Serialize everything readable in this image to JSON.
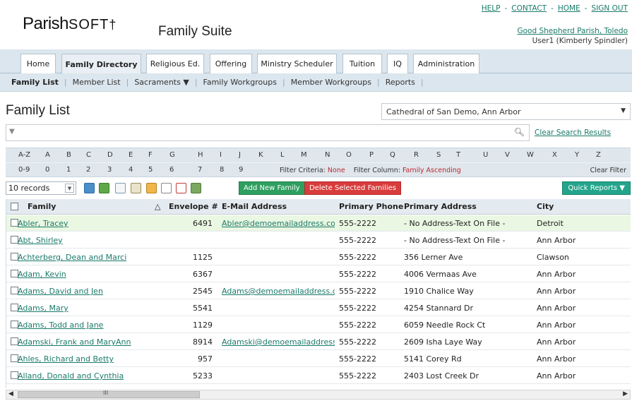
{
  "header": {
    "logo_main": "Parish",
    "logo_soft": "SOFT",
    "suite_title": "Family Suite",
    "links": [
      "HELP",
      "CONTACT",
      "HOME",
      "SIGN OUT"
    ],
    "parish_link": "Good Shepherd Parish, Toledo",
    "user_info": "User1 (Kimberly Spindler)"
  },
  "tabs": [
    {
      "label": "Home"
    },
    {
      "label": "Family Directory",
      "active": true
    },
    {
      "label": "Religious Ed."
    },
    {
      "label": "Offering"
    },
    {
      "label": "Ministry Scheduler"
    },
    {
      "label": "Tuition"
    },
    {
      "label": "IQ"
    },
    {
      "label": "Administration"
    }
  ],
  "subnav": {
    "family_list": "Family List",
    "member_list": "Member List",
    "sacraments": "Sacraments ▼",
    "family_workgroups": "Family Workgroups",
    "member_workgroups": "Member Workgroups",
    "reports": "Reports"
  },
  "page": {
    "title": "Family List",
    "parish_select": "Cathedral of San Demo, Ann Arbor",
    "clear_search": "Clear Search Results"
  },
  "alpha_row1": [
    "A-Z",
    "A",
    "B",
    "C",
    "D",
    "E",
    "F",
    "G",
    "H",
    "I",
    "J",
    "K",
    "L",
    "M",
    "N",
    "O",
    "P",
    "Q",
    "R",
    "S",
    "T",
    "U",
    "V",
    "W",
    "X",
    "Y",
    "Z"
  ],
  "alpha_row2": [
    "0-9",
    "0",
    "1",
    "2",
    "3",
    "4",
    "5",
    "6",
    "7",
    "8",
    "9"
  ],
  "filter": {
    "criteria_label": "Filter Criteria:",
    "criteria_value": "None",
    "column_label": "Filter Column:",
    "column_value": "Family Ascending",
    "clear_label": "Clear Filter"
  },
  "toolbar": {
    "records": "10 records",
    "add_button": "Add New Family",
    "delete_button": "Delete Selected Families",
    "quick_reports": "Quick Reports ▼"
  },
  "columns": {
    "family": "Family",
    "sort_indicator": "△",
    "envelope": "Envelope #",
    "email": "E-Mail Address",
    "phone": "Primary Phone",
    "address": "Primary Address",
    "city": "City"
  },
  "rows": [
    {
      "family": "Abler, Tracey",
      "envelope": "6491",
      "email": "Abler@demoemailaddress.com",
      "phone": "555-2222",
      "address": "- No Address-Text On File -",
      "city": "Detroit",
      "highlight": true
    },
    {
      "family": "Abt, Shirley",
      "envelope": "",
      "email": "",
      "phone": "555-2222",
      "address": "- No Address-Text On File -",
      "city": "Ann Arbor"
    },
    {
      "family": "Achterberg, Dean and Marci",
      "envelope": "1125",
      "email": "",
      "phone": "555-2222",
      "address": "356 Lerner Ave",
      "city": "Clawson"
    },
    {
      "family": "Adam, Kevin",
      "envelope": "6367",
      "email": "",
      "phone": "555-2222",
      "address": "4006 Vermaas Ave",
      "city": "Ann Arbor"
    },
    {
      "family": "Adams, David and Jen",
      "envelope": "2545",
      "email": "Adams@demoemailaddress.con",
      "phone": "555-2222",
      "address": "1910 Chalice Way",
      "city": "Ann Arbor"
    },
    {
      "family": "Adams, Mary",
      "envelope": "5541",
      "email": "",
      "phone": "555-2222",
      "address": "4254 Stannard Dr",
      "city": "Ann Arbor"
    },
    {
      "family": "Adams, Todd and Jane",
      "envelope": "1129",
      "email": "",
      "phone": "555-2222",
      "address": "6059 Needle Rock Ct",
      "city": "Ann Arbor"
    },
    {
      "family": "Adamski, Frank and MaryAnn",
      "envelope": "8914",
      "email": "Adamski@demoemailaddress.cc",
      "phone": "555-2222",
      "address": "2609 Isha Laye Way",
      "city": "Ann Arbor"
    },
    {
      "family": "Ahles, Richard and Betty",
      "envelope": "957",
      "email": "",
      "phone": "555-2222",
      "address": "5141 Corey Rd",
      "city": "Ann Arbor"
    },
    {
      "family": "Alland, Donald and Cynthia",
      "envelope": "5233",
      "email": "",
      "phone": "555-2222",
      "address": "2403 Lost Creek Dr",
      "city": "Ann Arbor"
    }
  ],
  "icons": {
    "filter": "filter-triangle-icon",
    "search": "magnifier-icon",
    "colors": {
      "link": "#1a7a6a",
      "add": "#2f9f60",
      "delete": "#d93c3c",
      "quick": "#23a58b",
      "highlight": "#eaf7e2"
    }
  }
}
